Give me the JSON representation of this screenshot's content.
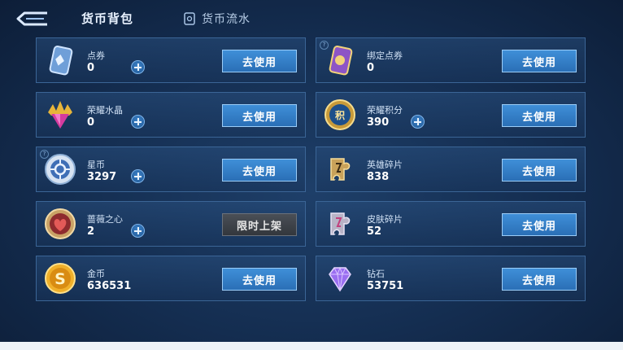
{
  "header": {
    "active_tab": "货币背包",
    "flow_tab": "货币流水"
  },
  "buttons": {
    "use": "去使用",
    "limited": "限时上架"
  },
  "left": [
    {
      "name": "点券",
      "value": "0",
      "icon": "coupon-icon",
      "button": "use"
    },
    {
      "name": "荣耀水晶",
      "value": "0",
      "icon": "glory-crystal-icon",
      "button": "use"
    },
    {
      "name": "星币",
      "value": "3297",
      "icon": "star-coin-icon",
      "button": "use"
    },
    {
      "name": "蔷薇之心",
      "value": "2",
      "icon": "rose-heart-icon",
      "button": "limited"
    },
    {
      "name": "金币",
      "value": "636531",
      "icon": "gold-coin-icon",
      "button": "use"
    }
  ],
  "right": [
    {
      "name": "绑定点券",
      "value": "0",
      "icon": "bound-coupon-icon",
      "button": "use"
    },
    {
      "name": "荣耀积分",
      "value": "390",
      "icon": "glory-points-icon",
      "button": "use"
    },
    {
      "name": "英雄碎片",
      "value": "838",
      "icon": "hero-fragment-icon",
      "button": "use"
    },
    {
      "name": "皮肤碎片",
      "value": "52",
      "icon": "skin-fragment-icon",
      "button": "use"
    },
    {
      "name": "钻石",
      "value": "53751",
      "icon": "diamond-icon",
      "button": "use"
    }
  ],
  "colors": {
    "background": "#142d50",
    "card_border": "#3b6596",
    "use_button": "#3f8fd8",
    "limited_button": "#4a4f57"
  }
}
